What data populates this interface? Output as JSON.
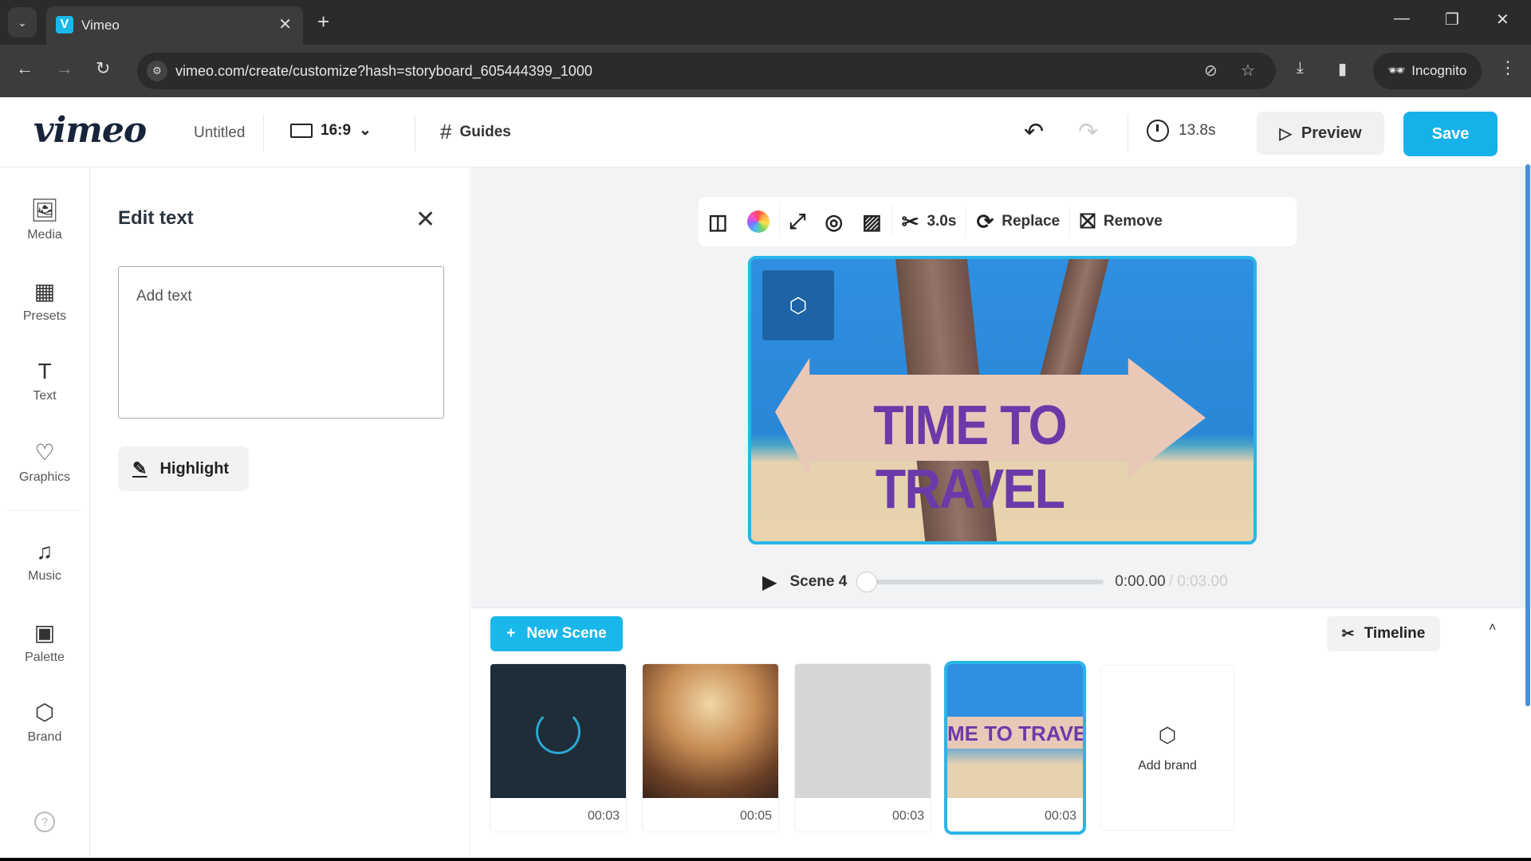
{
  "browser": {
    "tab_title": "Vimeo",
    "tab_favicon": "V",
    "new_tab_label": "+",
    "url": "vimeo.com/create/customize?hash=storyboard_605444399_1000",
    "profile_label": "Incognito",
    "icons": {
      "back": "←",
      "forward": "→",
      "reload": "↻",
      "tune": "⚙",
      "eye_off": "⊘",
      "star": "☆",
      "download": "⤓",
      "sidepanel": "▮",
      "incognito": "🕶",
      "menu": "⋮",
      "minimize": "—",
      "restore": "❐",
      "close": "✕",
      "tab_list": "⌄",
      "tab_close": "✕"
    }
  },
  "header": {
    "logo": "vimeo",
    "title": "Untitled",
    "aspect_ratio": "16:9",
    "aspect_chevron": "⌄",
    "guides_label": "Guides",
    "guides_icon": "#",
    "undo_icon": "↶",
    "redo_icon": "↷",
    "duration": "13.8s",
    "preview_label": "Preview",
    "preview_icon": "▷",
    "save_label": "Save"
  },
  "sidebar": {
    "items": [
      {
        "label": "Media",
        "icon": "🖼"
      },
      {
        "label": "Presets",
        "icon": "▦"
      },
      {
        "label": "Text",
        "icon": "T"
      },
      {
        "label": "Graphics",
        "icon": "♡"
      },
      {
        "label": "Music",
        "icon": "♫"
      },
      {
        "label": "Palette",
        "icon": "▣"
      },
      {
        "label": "Brand",
        "icon": "⬡"
      }
    ],
    "help_icon": "?"
  },
  "edit_panel": {
    "title": "Edit text",
    "close_icon": "✕",
    "text_value": "",
    "text_placeholder": "Add text",
    "highlight_label": "Highlight",
    "highlight_icon": "✎"
  },
  "toolbar": {
    "layout_icon": "◫",
    "color_icon": "color-wheel",
    "expand_icon": "⤢",
    "overlay_icon": "◎",
    "mask_icon": "▨",
    "trim_icon": "✂",
    "trim_duration": "3.0s",
    "replace_label": "Replace",
    "replace_icon": "⟳",
    "remove_label": "Remove",
    "remove_icon": "⛝"
  },
  "preview": {
    "sign_text": "TIME TO TRAVEL",
    "brand_icon": "⬡"
  },
  "player": {
    "play_icon": "▶",
    "scene_label": "Scene 4",
    "progress": 0,
    "current_time": "0:00.00",
    "total_time": "/ 0:03.00"
  },
  "storyboard": {
    "new_scene_label": "New Scene",
    "new_scene_icon": "+",
    "timeline_label": "Timeline",
    "timeline_icon": "✂",
    "collapse_icon": "˄",
    "scenes": [
      {
        "duration": "00:03",
        "thumb": "loading"
      },
      {
        "duration": "00:05",
        "thumb": "concert-heart-hands"
      },
      {
        "duration": "00:03",
        "thumb": "blank"
      },
      {
        "duration": "00:03",
        "thumb": "time-to-travel",
        "thumb_text": "ME TO TRAVEL",
        "selected": true
      }
    ],
    "add_brand_label": "Add brand",
    "add_brand_icon": "⬡"
  },
  "colors": {
    "accent": "#17b1ea",
    "selection": "#29b5ea",
    "brand_badge": "#1d64a6",
    "sign_text": "#6b3aa8"
  }
}
